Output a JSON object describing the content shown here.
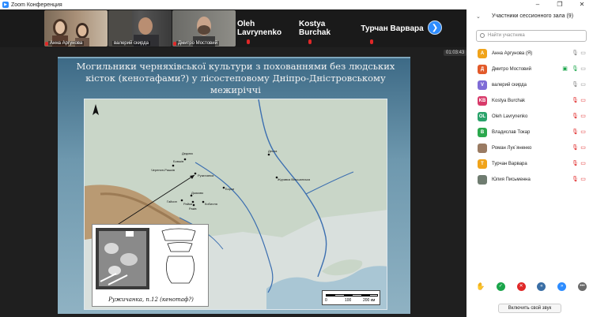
{
  "window": {
    "title": "Zoom Конференция"
  },
  "gallery": {
    "tiles": [
      {
        "name": "Анна Аргунова"
      },
      {
        "name": "валерий скирда"
      },
      {
        "name": "Дмитро Мостовий"
      }
    ],
    "name_tiles": [
      "Oleh Lavrynenko",
      "Kostya Burchak",
      "Турчан Варвара"
    ],
    "timer": "01:03:43"
  },
  "slide": {
    "title": "Могильники черняхівської культури з похованнями без людських кісток (кенотафами?) у лісостеповому Дніпро-Дністровському межиріччі",
    "inset_caption": "Ружичанка, п.12 (кенотаф?)",
    "map_labels": [
      "Черепин-Рашків",
      "Бовшів",
      "Ружичанка",
      "Дедова",
      "Десна",
      "Журавка Вільшанська",
      "Борки",
      "Дьяково",
      "Гайсин",
      "Райки",
      "Кобилля",
      "Раків"
    ],
    "scale": {
      "t0": "0",
      "t1": "100",
      "t2": "200 км"
    }
  },
  "sidebar": {
    "title": "Участники сессионного зала (9)",
    "search_placeholder": "Найти участника",
    "participants": [
      {
        "initial": "А",
        "name": "Анна Аргунова (Я)",
        "color": "#f0a31a"
      },
      {
        "initial": "Д",
        "name": "Дмитро Мостовий",
        "color": "#e25a2a"
      },
      {
        "initial": "V",
        "name": "валерий скирда",
        "color": "#7f6cd6"
      },
      {
        "initial": "KB",
        "name": "Kostya Burchak",
        "color": "#d83a6a"
      },
      {
        "initial": "OL",
        "name": "Oleh Lavrynenko",
        "color": "#2aa36b"
      },
      {
        "initial": "В",
        "name": "Владислав Токар",
        "color": "#2ba84d"
      },
      {
        "initial": "",
        "name": "Роман Лук`яненко",
        "color": "#9a7b63"
      },
      {
        "initial": "Т",
        "name": "Турчан Варвара",
        "color": "#f0a31a"
      },
      {
        "initial": "",
        "name": "Юлия Письменна",
        "color": "#6f7c70"
      }
    ],
    "unmute_label": "Включить свой звук"
  }
}
